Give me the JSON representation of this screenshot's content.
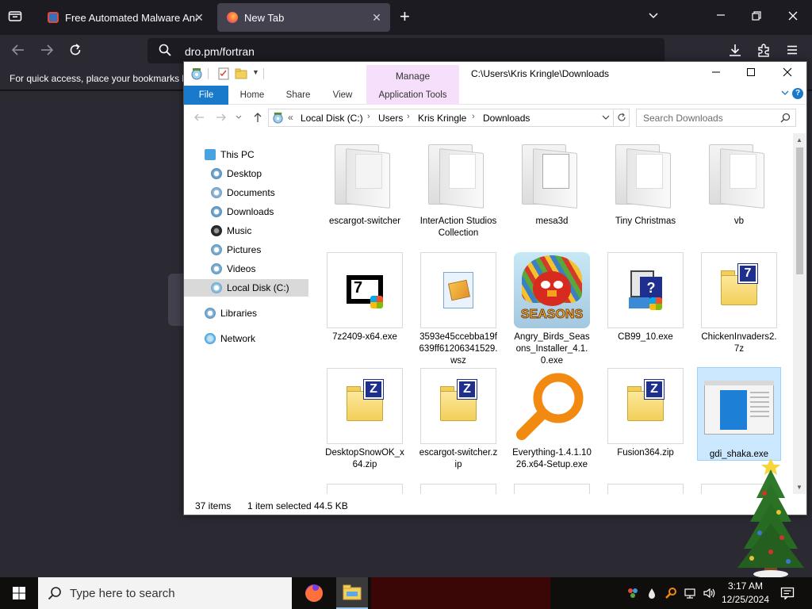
{
  "browser": {
    "tabs": [
      {
        "title": "Free Automated Malware Analy",
        "close": "✕"
      },
      {
        "title": "New Tab",
        "close": "✕"
      }
    ],
    "new_tab": "+",
    "url": "dro.pm/fortran",
    "bookmark_hint": "For quick access, place your bookmarks h"
  },
  "explorer": {
    "title": "C:\\Users\\Kris Kringle\\Downloads",
    "manage_label": "Manage",
    "ribbon_tabs": [
      "File",
      "Home",
      "Share",
      "View",
      "Application Tools"
    ],
    "breadcrumb": [
      "Local Disk (C:)",
      "Users",
      "Kris Kringle",
      "Downloads"
    ],
    "breadcrumb_prefix": "«",
    "search_placeholder": "Search Downloads",
    "nav": {
      "this_pc": "This PC",
      "items": [
        "Desktop",
        "Documents",
        "Downloads",
        "Music",
        "Pictures",
        "Videos",
        "Local Disk (C:)"
      ],
      "libraries": "Libraries",
      "network": "Network",
      "selected": "Local Disk (C:)"
    },
    "files": [
      {
        "name": "escargot-switcher",
        "kind": "folder"
      },
      {
        "name": "InterAction Studios Collection",
        "kind": "folder"
      },
      {
        "name": "mesa3d",
        "kind": "folder"
      },
      {
        "name": "Tiny Christmas",
        "kind": "folder"
      },
      {
        "name": "vb",
        "kind": "folder"
      },
      {
        "name": "7z2409-x64.exe",
        "kind": "exe-7z"
      },
      {
        "name": "3593e45ccebba19f639ff61206341529.wsz",
        "kind": "wsz"
      },
      {
        "name": "Angry_Birds_Seasons_Installer_4.1.0.exe",
        "kind": "angry-birds",
        "badge": "SEASONS"
      },
      {
        "name": "CB99_10.exe",
        "kind": "installer"
      },
      {
        "name": "ChickenInvaders2.7z",
        "kind": "7z-archive"
      },
      {
        "name": "DesktopSnowOK_x64.zip",
        "kind": "zip"
      },
      {
        "name": "escargot-switcher.zip",
        "kind": "zip"
      },
      {
        "name": "Everything-1.4.1.1026.x64-Setup.exe",
        "kind": "everything"
      },
      {
        "name": "Fusion364.zip",
        "kind": "zip"
      },
      {
        "name": "gdi_shaka.exe",
        "kind": "window-exe",
        "selected": true
      }
    ],
    "status": {
      "count": "37 items",
      "selection": "1 item selected",
      "size": "44.5 KB"
    }
  },
  "taskbar": {
    "search_text": "Type here to search",
    "time": "3:17 AM",
    "date": "12/25/2024"
  },
  "colors": {
    "accent": "#1979ca",
    "manage": "#f5dffb",
    "selection": "#cce8ff",
    "browser_bg": "#1c1b22"
  }
}
